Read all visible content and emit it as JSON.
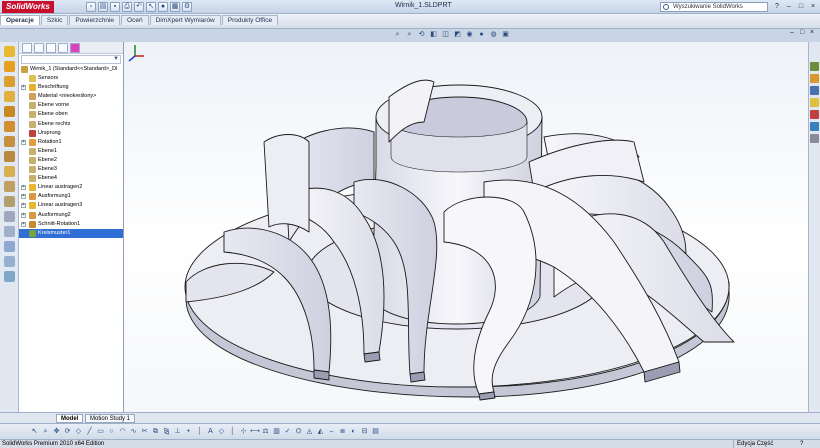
{
  "app": {
    "logo": "SolidWorks",
    "document_title": "Wirnik_1.SLDPRT",
    "search_placeholder": "Wyszukiwanie SolidWorks",
    "help_label": "?",
    "window_controls": [
      "–",
      "□",
      "×"
    ]
  },
  "ribbon": {
    "tabs": [
      {
        "label": "Operacje",
        "active": true
      },
      {
        "label": "Szkic",
        "active": false
      },
      {
        "label": "Powierzchnie",
        "active": false
      },
      {
        "label": "Oceń",
        "active": false
      },
      {
        "label": "DimXpert Wymiarów",
        "active": false
      },
      {
        "label": "Produkty Office",
        "active": false
      }
    ]
  },
  "feature_tree": {
    "root": "Wirnik_1 (Standard<<Standard>_Di",
    "items": [
      {
        "label": "Sensors",
        "icon": "sensor-icon",
        "expandable": false
      },
      {
        "label": "Beschriftung",
        "icon": "annotation-icon",
        "expandable": true
      },
      {
        "label": "Material <nieokreślony>",
        "icon": "material-icon",
        "expandable": false
      },
      {
        "label": "Ebene vorne",
        "icon": "plane-icon",
        "expandable": false
      },
      {
        "label": "Ebene oben",
        "icon": "plane-icon",
        "expandable": false
      },
      {
        "label": "Ebene rechts",
        "icon": "plane-icon",
        "expandable": false
      },
      {
        "label": "Ursprung",
        "icon": "origin-icon",
        "expandable": false
      },
      {
        "label": "Rotation1",
        "icon": "revolve-icon",
        "expandable": true
      },
      {
        "label": "Ebene1",
        "icon": "plane-icon",
        "expandable": false
      },
      {
        "label": "Ebene2",
        "icon": "plane-icon",
        "expandable": false
      },
      {
        "label": "Ebene3",
        "icon": "plane-icon",
        "expandable": false
      },
      {
        "label": "Ebene4",
        "icon": "plane-icon",
        "expandable": false
      },
      {
        "label": "Linear austragen2",
        "icon": "extrude-icon",
        "expandable": true
      },
      {
        "label": "Ausformung1",
        "icon": "loft-icon",
        "expandable": true
      },
      {
        "label": "Linear austragen3",
        "icon": "extrude-icon",
        "expandable": true
      },
      {
        "label": "Ausformung2",
        "icon": "loft-icon",
        "expandable": true
      },
      {
        "label": "Schnitt-Rotation1",
        "icon": "revolve-cut-icon",
        "expandable": true
      },
      {
        "label": "Kreismuster1",
        "icon": "circular-pattern-icon",
        "expandable": false,
        "selected": true
      }
    ]
  },
  "model_tabs": [
    {
      "label": "Model",
      "active": true
    },
    {
      "label": "Motion Study 1",
      "active": false
    }
  ],
  "status": {
    "left": "SolidWorks Premium 2010 x64 Edition",
    "mode": "Edycja Część",
    "help": "?"
  },
  "colors": {
    "logo_red": "#c8102e",
    "part_face": "#f3f3f8",
    "part_shade": "#c8c9d8",
    "edge": "#1a1a1a",
    "selection": "#2f6fd6"
  }
}
